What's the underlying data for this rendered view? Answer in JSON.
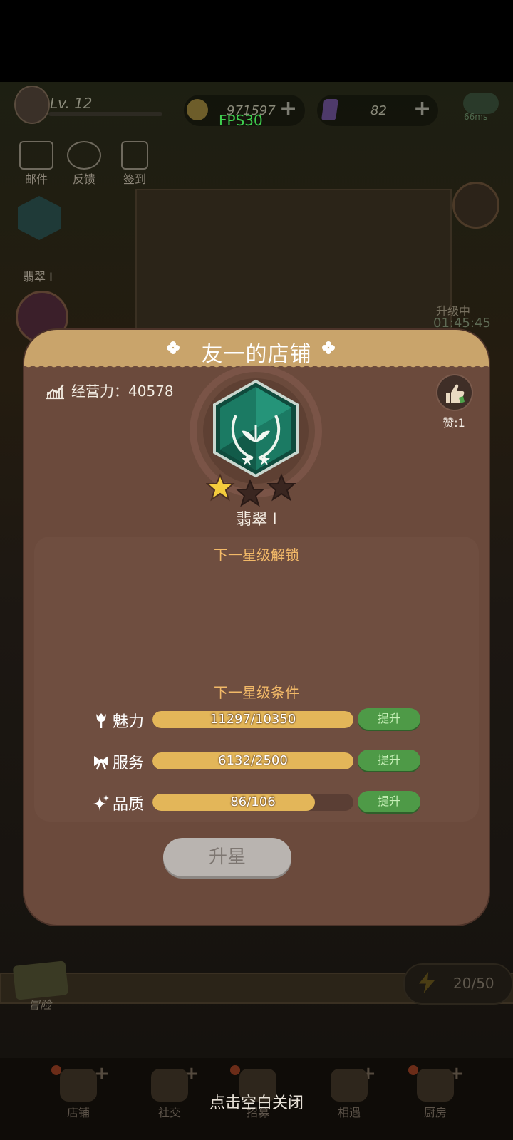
{
  "topbar": {
    "level": "Lv. 12",
    "gold": "971597",
    "gem": "82",
    "ping": "66ms"
  },
  "fps": "FPS30",
  "side": {
    "mail": "邮件",
    "feedback": "反馈",
    "checkin": "签到",
    "rank_short": "翡翠 I",
    "upgrade_status": "升级中",
    "upgrade_timer": "01:45:45",
    "adventure": "冒险",
    "energy": "20/50"
  },
  "dialog": {
    "title": "友一的店铺",
    "power_label": "经营力：40578",
    "like_label": "赞:1",
    "rank_name": "翡翠 I",
    "stars_filled": 1,
    "stars_total": 3,
    "next_unlock_title": "下一星级解锁",
    "next_cond_title": "下一星级条件",
    "conditions": [
      {
        "name": "魅力",
        "value": "11297/10350",
        "progress": 1.0,
        "button": "提升"
      },
      {
        "name": "服务",
        "value": "6132/2500",
        "progress": 1.0,
        "button": "提升"
      },
      {
        "name": "品质",
        "value": "86/106",
        "progress": 0.81,
        "button": "提升"
      }
    ],
    "star_up_button": "升星"
  },
  "bottom_nav": {
    "items": [
      "店铺",
      "社交",
      "招募",
      "相遇",
      "厨房"
    ]
  },
  "close_hint": "点击空白关闭",
  "colors": {
    "dialog_bg": "#6b4a3c",
    "header": "#c9a46b",
    "bar_fill": "#e3b659",
    "button_green": "#4e9a47",
    "section_title": "#f2b968"
  }
}
